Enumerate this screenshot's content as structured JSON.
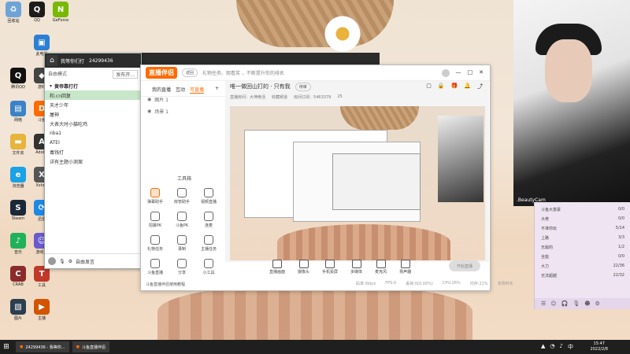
{
  "desktop": {
    "icons": [
      {
        "label": "回收站",
        "color": "#6fa3d8",
        "glyph": "♻"
      },
      {
        "label": "QQ",
        "color": "#1b1b1b",
        "glyph": "Q"
      },
      {
        "label": "GeForce",
        "color": "#76b900",
        "glyph": "N"
      },
      {
        "label": "此电脑",
        "color": "#2d7fd3",
        "glyph": "▣"
      },
      {
        "label": "腾讯QQ",
        "color": "#111",
        "glyph": "Q"
      },
      {
        "label": "游戏",
        "color": "#444",
        "glyph": "◆"
      },
      {
        "label": "网络",
        "color": "#3c82c7",
        "glyph": "▤"
      },
      {
        "label": "斗鱼",
        "color": "#ff6a00",
        "glyph": "D"
      },
      {
        "label": "文件夹",
        "color": "#e7b53c",
        "glyph": "▬"
      },
      {
        "label": "Adobe",
        "color": "#333",
        "glyph": "A"
      },
      {
        "label": "浏览器",
        "color": "#1aa1e6",
        "glyph": "e"
      },
      {
        "label": "Xshell",
        "color": "#555",
        "glyph": "X"
      },
      {
        "label": "Steam",
        "color": "#1b2838",
        "glyph": "S"
      },
      {
        "label": "迅雷",
        "color": "#1e88e5",
        "glyph": "⟳"
      },
      {
        "label": "音乐",
        "color": "#20b15a",
        "glyph": "♪"
      },
      {
        "label": "游戏盒",
        "color": "#6a5acd",
        "glyph": "☺"
      },
      {
        "label": "CRAB",
        "color": "#8b2b2b",
        "glyph": "C"
      },
      {
        "label": "工具",
        "color": "#c0392b",
        "glyph": "T"
      },
      {
        "label": "图片",
        "color": "#2c3e50",
        "glyph": "▧"
      },
      {
        "label": "主播",
        "color": "#d35400",
        "glyph": "▶"
      }
    ]
  },
  "qq": {
    "title": "我等你们打",
    "id": "24299436",
    "mode": "自由模式",
    "search": "发布开...",
    "group": "黄帝靠打打",
    "rows": [
      "和.cn回复",
      "天才少年",
      "屠神",
      "大表大时小猫吃鸡",
      "nba1",
      "ATEI",
      "毒钱打",
      "详有主题小测案"
    ],
    "footer": "自由发言"
  },
  "main": {
    "logo": "直播伴侣",
    "back": "返回",
    "notice": "礼物任务、观看奖 ，不断提升你的排名",
    "tabs": [
      "我的直播",
      "互动",
      "可直播"
    ],
    "scenes": [
      "图片 1",
      "场景 1"
    ],
    "tools_title": "工具箱",
    "tools": [
      "弹幕助手",
      "房管助手",
      "视频直播",
      "招募PK",
      "斗鱼PK",
      "连麦",
      "礼物任务",
      "录制",
      "主播任务",
      "斗鱼直播",
      "分享",
      "小工具"
    ],
    "stage_title": "唯一做回山打的 · 只有我",
    "stage_badge": "待审",
    "stage_sub": [
      "直播房间：大神绝活",
      "收藏频道",
      "房间订阅：5463379",
      "25"
    ],
    "bottom_buttons": [
      "直播画面",
      "摄像头",
      "手机投屏",
      "多媒体",
      "麦克风",
      "扬声器"
    ],
    "start": "开始直播",
    "status": [
      "码率:0kb/s",
      "FPS:0",
      "丢帧:0(0.00%)",
      "CPU:26%",
      "内存:21%",
      "本场时长"
    ],
    "left_foot": "斗鱼直播伴侣使用教程"
  },
  "cam": {
    "label": ".BeautyCam"
  },
  "chat": {
    "rows": [
      [
        "斗鱼大富豪",
        "0/0"
      ],
      [
        "大佬",
        "0/0"
      ],
      [
        "不准你玩",
        "5/14"
      ],
      [
        "上路",
        "3/3"
      ],
      [
        "无敌的",
        "1/2"
      ],
      [
        "全能",
        "0/0"
      ],
      [
        "大力",
        "22/36"
      ],
      [
        "无法超越",
        "22/32"
      ]
    ]
  },
  "taskbar": {
    "items": [
      "24299436 - 我等你...",
      "斗鱼直播伴侣"
    ],
    "time": "15:47",
    "date": "2022/2/8"
  }
}
